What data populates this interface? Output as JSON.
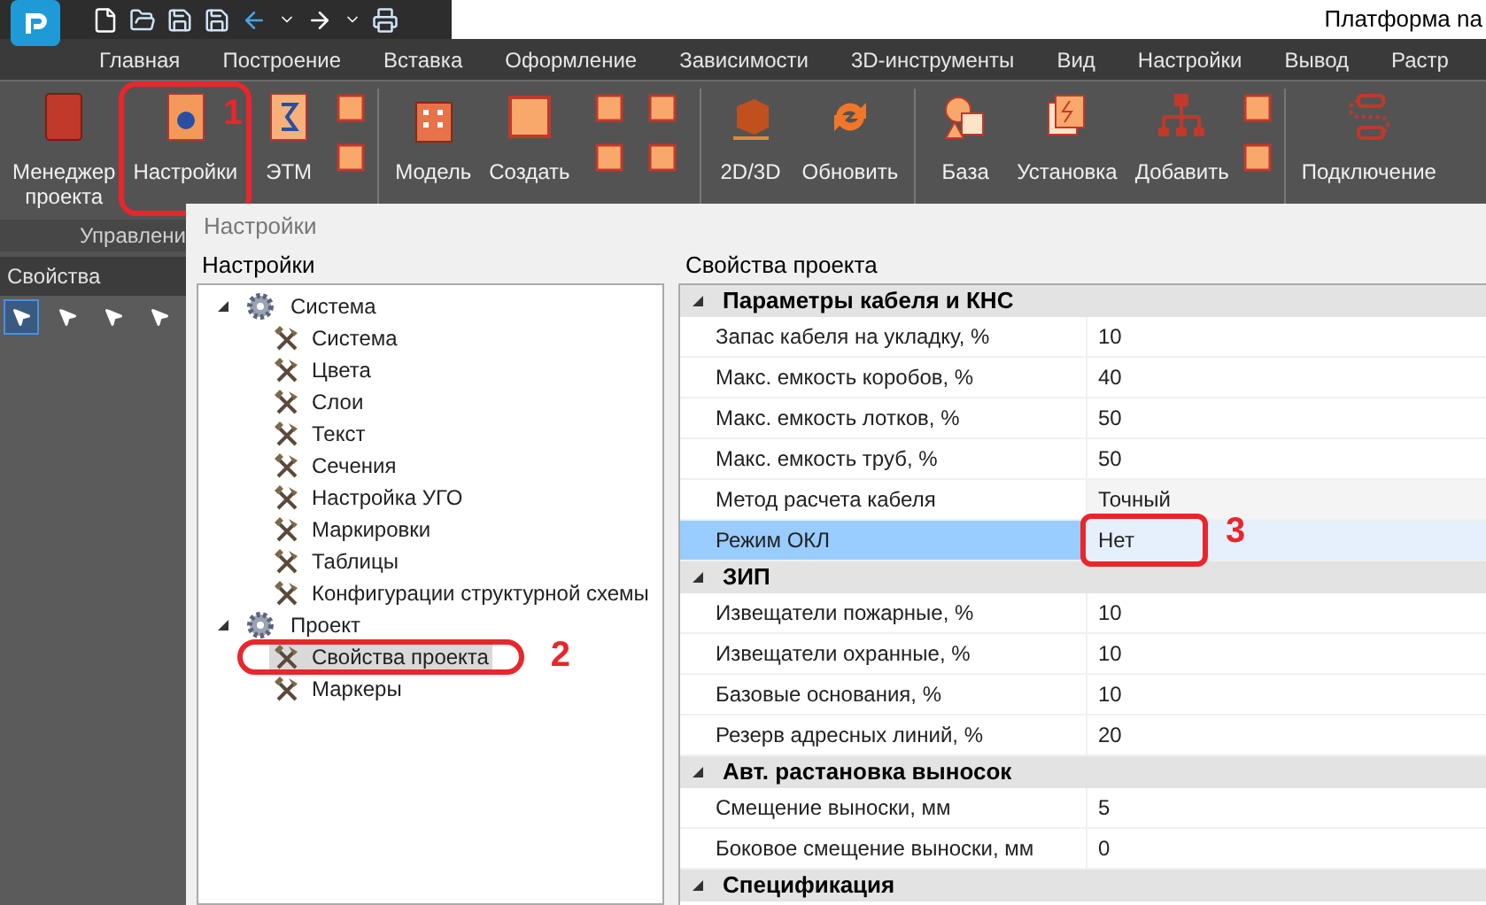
{
  "title_bar": {
    "app_title": "Платформа na"
  },
  "menu_tabs": [
    "Главная",
    "Построение",
    "Вставка",
    "Оформление",
    "Зависимости",
    "3D-инструменты",
    "Вид",
    "Настройки",
    "Вывод",
    "Растр"
  ],
  "ribbon": {
    "items": [
      {
        "kind": "large",
        "lines": [
          "Менеджер",
          "проекта"
        ]
      },
      {
        "kind": "large",
        "lines": [
          "Настройки"
        ],
        "marker": "1"
      },
      {
        "kind": "large",
        "lines": [
          "ЭТМ"
        ]
      },
      {
        "kind": "small_stack"
      },
      {
        "kind": "separator"
      },
      {
        "kind": "large",
        "lines": [
          "Модель"
        ]
      },
      {
        "kind": "large",
        "lines": [
          "Создать"
        ]
      },
      {
        "kind": "small_grid"
      },
      {
        "kind": "separator"
      },
      {
        "kind": "large",
        "lines": [
          "2D/3D"
        ]
      },
      {
        "kind": "large",
        "lines": [
          "Обновить"
        ]
      },
      {
        "kind": "separator"
      },
      {
        "kind": "large",
        "lines": [
          "База"
        ]
      },
      {
        "kind": "large",
        "lines": [
          "Установка"
        ]
      },
      {
        "kind": "large",
        "lines": [
          "Добавить"
        ]
      },
      {
        "kind": "small_stack"
      },
      {
        "kind": "separator"
      },
      {
        "kind": "large",
        "lines": [
          "Подключение"
        ]
      }
    ],
    "group_label": "Управлени"
  },
  "properties_panel": {
    "title": "Свойства",
    "tools": [
      {
        "selected": true
      },
      {
        "selected": false
      },
      {
        "selected": false
      },
      {
        "selected": false
      }
    ]
  },
  "dialog": {
    "title": "Настройки",
    "tree_group": "Настройки",
    "tree": [
      {
        "label": "Система",
        "expanded": true,
        "children": [
          {
            "label": "Система",
            "selected": false
          },
          {
            "label": "Цвета",
            "selected": false
          },
          {
            "label": "Слои",
            "selected": false
          },
          {
            "label": "Текст",
            "selected": false
          },
          {
            "label": "Сечения",
            "selected": false
          },
          {
            "label": "Настройка УГО",
            "selected": false
          },
          {
            "label": "Маркировки",
            "selected": false
          },
          {
            "label": "Таблицы",
            "selected": false
          },
          {
            "label": "Конфигурации структурной схемы",
            "selected": false
          }
        ]
      },
      {
        "label": "Проект",
        "expanded": true,
        "children": [
          {
            "label": "Свойства проекта",
            "selected": true,
            "marker": "2"
          },
          {
            "label": "Маркеры",
            "selected": false
          }
        ]
      }
    ],
    "grid_group": "Свойства проекта",
    "grid": [
      {
        "category": "Параметры кабеля и КНС",
        "expanded": true,
        "rows": [
          {
            "name": "Запас кабеля на укладку, %",
            "value": "10",
            "kind": "text",
            "selected": false
          },
          {
            "name": "Макс. емкость коробов, %",
            "value": "40",
            "kind": "text",
            "selected": false
          },
          {
            "name": "Макс. емкость лотков, %",
            "value": "50",
            "kind": "text",
            "selected": false
          },
          {
            "name": "Макс. емкость труб, %",
            "value": "50",
            "kind": "text",
            "selected": false
          },
          {
            "name": "Метод расчета кабеля",
            "value": "Точный",
            "kind": "choice",
            "selected": false
          },
          {
            "name": "Режим ОКЛ",
            "value": "Нет",
            "kind": "text",
            "selected": true,
            "marker": "3"
          }
        ]
      },
      {
        "category": "ЗИП",
        "expanded": true,
        "rows": [
          {
            "name": "Извещатели пожарные, %",
            "value": "10",
            "kind": "text",
            "selected": false
          },
          {
            "name": "Извещатели охранные, %",
            "value": "10",
            "kind": "text",
            "selected": false
          },
          {
            "name": "Базовые основания, %",
            "value": "10",
            "kind": "text",
            "selected": false
          },
          {
            "name": "Резерв адресных линий, %",
            "value": "20",
            "kind": "text",
            "selected": false
          }
        ]
      },
      {
        "category": "Авт. растановка выносок",
        "expanded": true,
        "rows": [
          {
            "name": "Смещение выноски, мм",
            "value": "5",
            "kind": "text",
            "selected": false
          },
          {
            "name": "Боковое смещение выноски, мм",
            "value": "0",
            "kind": "text",
            "selected": false
          }
        ]
      },
      {
        "category": "Спецификация",
        "expanded": true
      }
    ]
  }
}
